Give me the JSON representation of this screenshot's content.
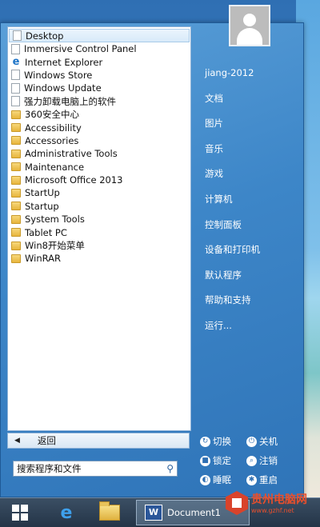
{
  "start_menu": {
    "programs": [
      {
        "label": "Desktop",
        "icon": "file-icon",
        "kind": "file",
        "selected": true
      },
      {
        "label": "Immersive Control Panel",
        "icon": "file-icon",
        "kind": "file"
      },
      {
        "label": "Internet Explorer",
        "icon": "ie-icon",
        "kind": "ie"
      },
      {
        "label": "Windows Store",
        "icon": "file-icon",
        "kind": "file"
      },
      {
        "label": "Windows Update",
        "icon": "file-icon",
        "kind": "file"
      },
      {
        "label": "强力卸载电脑上的软件",
        "icon": "file-icon",
        "kind": "file"
      },
      {
        "label": "360安全中心",
        "icon": "folder-icon",
        "kind": "folder"
      },
      {
        "label": "Accessibility",
        "icon": "folder-icon",
        "kind": "folder"
      },
      {
        "label": "Accessories",
        "icon": "folder-icon",
        "kind": "folder"
      },
      {
        "label": "Administrative Tools",
        "icon": "folder-icon",
        "kind": "folder"
      },
      {
        "label": "Maintenance",
        "icon": "folder-icon",
        "kind": "folder"
      },
      {
        "label": "Microsoft Office 2013",
        "icon": "folder-icon",
        "kind": "folder"
      },
      {
        "label": "StartUp",
        "icon": "folder-icon",
        "kind": "folder"
      },
      {
        "label": "Startup",
        "icon": "folder-icon",
        "kind": "folder"
      },
      {
        "label": "System Tools",
        "icon": "folder-icon",
        "kind": "folder"
      },
      {
        "label": "Tablet PC",
        "icon": "folder-icon",
        "kind": "folder"
      },
      {
        "label": "Win8开始菜单",
        "icon": "folder-icon",
        "kind": "folder"
      },
      {
        "label": "WinRAR",
        "icon": "folder-icon",
        "kind": "folder"
      }
    ],
    "back_label": "返回",
    "search_placeholder": "搜索程序和文件",
    "user_name": "jiang-2012",
    "right_links": [
      "文档",
      "图片",
      "音乐",
      "游戏",
      "计算机",
      "控制面板",
      "设备和打印机",
      "默认程序",
      "帮助和支持",
      "运行..."
    ],
    "power": {
      "switch": "切换",
      "shutdown": "关机",
      "lock": "锁定",
      "logoff": "注销",
      "sleep": "睡眠",
      "restart": "重启"
    }
  },
  "taskbar": {
    "word_window_label": "Document1"
  },
  "watermark": {
    "text": "贵州电脑网",
    "url": "www.gzhf.net"
  }
}
